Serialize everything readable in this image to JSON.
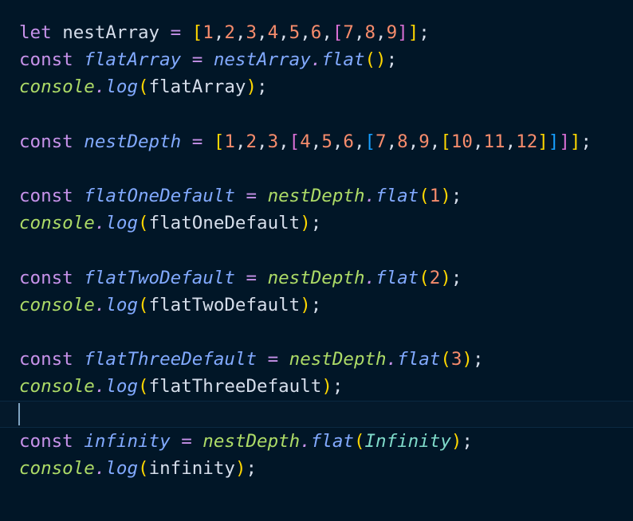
{
  "colors": {
    "background": "#011627",
    "keyword": "#c792ea",
    "declaration": "#82aaff",
    "object": "#addb67",
    "number": "#f78c6c",
    "plain": "#d6deeb",
    "bracket_gold": "#ffd700",
    "bracket_orchid": "#da70d6",
    "bracket_blue": "#179fff",
    "infinity": "#7fdbca"
  },
  "code": {
    "l1": {
      "kw": "let",
      "name": "nestArray",
      "eq": "=",
      "arr": [
        "1",
        "2",
        "3",
        "4",
        "5",
        "6",
        "7",
        "8",
        "9"
      ]
    },
    "l2": {
      "kw": "const",
      "name": "flatArray",
      "eq": "=",
      "obj": "nestArray",
      "method": "flat"
    },
    "l3": {
      "obj": "console",
      "method": "log",
      "arg": "flatArray"
    },
    "l5": {
      "kw": "const",
      "name": "nestDepth",
      "eq": "=",
      "arr": [
        "1",
        "2",
        "3",
        "4",
        "5",
        "6",
        "7",
        "8",
        "9",
        "10",
        "11",
        "12"
      ]
    },
    "l7": {
      "kw": "const",
      "name": "flatOneDefault",
      "eq": "=",
      "obj": "nestDepth",
      "method": "flat",
      "arg": "1"
    },
    "l8": {
      "obj": "console",
      "method": "log",
      "arg": "flatOneDefault"
    },
    "l10": {
      "kw": "const",
      "name": "flatTwoDefault",
      "eq": "=",
      "obj": "nestDepth",
      "method": "flat",
      "arg": "2"
    },
    "l11": {
      "obj": "console",
      "method": "log",
      "arg": "flatTwoDefault"
    },
    "l13": {
      "kw": "const",
      "name": "flatThreeDefault",
      "eq": "=",
      "obj": "nestDepth",
      "method": "flat",
      "arg": "3"
    },
    "l14": {
      "obj": "console",
      "method": "log",
      "arg": "flatThreeDefault"
    },
    "l16": {
      "kw": "const",
      "name": "infinity",
      "eq": "=",
      "obj": "nestDepth",
      "method": "flat",
      "arg": "Infinity"
    },
    "l17": {
      "obj": "console",
      "method": "log",
      "arg": "infinity"
    }
  }
}
